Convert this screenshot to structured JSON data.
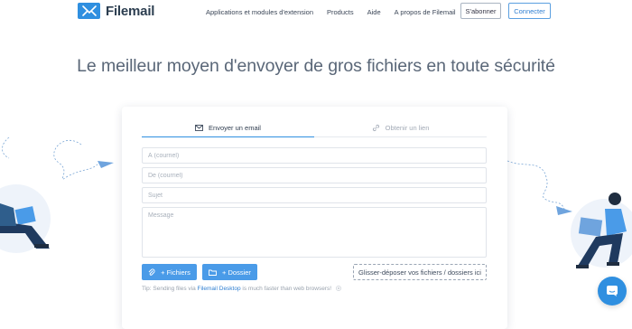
{
  "header": {
    "logo_text": "Filemail",
    "nav": [
      {
        "label": "Applications et modules d'extension"
      },
      {
        "label": "Products"
      },
      {
        "label": "Aide"
      },
      {
        "label": "A propos de Filemail"
      }
    ],
    "subscribe_label": "S'abonner",
    "connect_label": "Connecter"
  },
  "headline": "Le meilleur moyen d'envoyer de gros fichiers en toute sécurité",
  "form": {
    "tabs": [
      {
        "label": "Envoyer un email",
        "icon": "envelope-icon",
        "active": true
      },
      {
        "label": "Obtenir un lien",
        "icon": "link-icon",
        "active": false
      }
    ],
    "to_placeholder": "À (courriel)",
    "from_placeholder": "De (courriel)",
    "subject_placeholder": "Sujet",
    "message_placeholder": "Message",
    "add_files_label": "+ Fichiers",
    "add_folder_label": "+ Dossier",
    "dropzone_label": "Glisser-déposer vos fichiers / dossiers ici",
    "tip_prefix": "Tip: Sending files via ",
    "tip_link": "Filemail Desktop",
    "tip_suffix": " is much faster than web browsers!"
  },
  "colors": {
    "accent": "#2f8fe0",
    "button_blue": "#4a9be8",
    "title": "#5a6778",
    "muted": "#a2aab6"
  }
}
